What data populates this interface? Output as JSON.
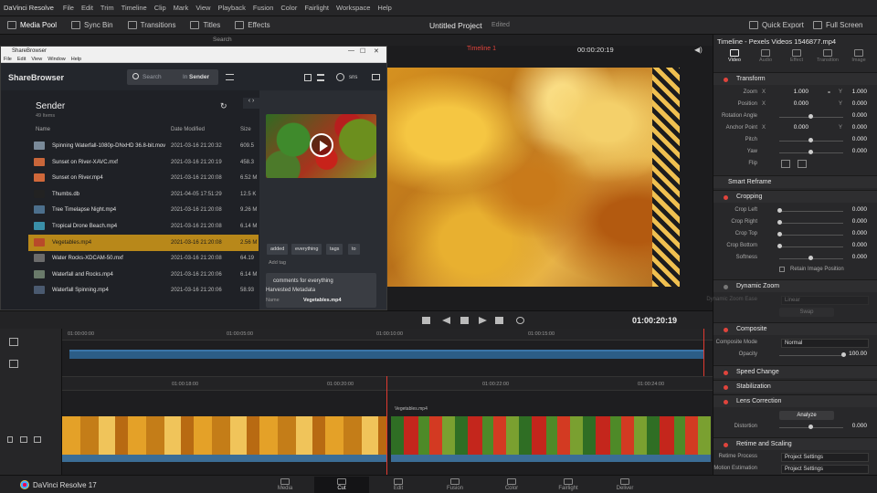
{
  "menubar": {
    "app_name": "DaVinci Resolve",
    "items": [
      "File",
      "Edit",
      "Trim",
      "Timeline",
      "Clip",
      "Mark",
      "View",
      "Playback",
      "Fusion",
      "Color",
      "Fairlight",
      "Workspace",
      "Help"
    ]
  },
  "toolbar": {
    "buttons": [
      "Media Pool",
      "Sync Bin",
      "Transitions",
      "Titles",
      "Effects"
    ],
    "project_title": "Untitled Project",
    "project_status": "Edited",
    "quick_export": "Quick Export",
    "full_screen": "Full Screen"
  },
  "subbar": {
    "search_label": "Search"
  },
  "sharebrowser": {
    "window_title": "ShareBrowser",
    "menu": [
      "File",
      "Edit",
      "View",
      "Window",
      "Help"
    ],
    "brand": "ShareBrowser",
    "search_placeholder": "Search",
    "search_in": "In",
    "search_scope": "Sender",
    "user": "sns",
    "folder": "Sender",
    "item_count": "49 Items",
    "columns": [
      "Name",
      "Date Modified",
      "Size"
    ],
    "rows": [
      {
        "name": "Spinning Waterfall-1080p-DNxHD 36.8-bit.mov",
        "date": "2021-03-16 21:20:32",
        "size": "609.5"
      },
      {
        "name": "Sunset on River-XAVC.mxf",
        "date": "2021-03-16 21:20:19",
        "size": "458.3"
      },
      {
        "name": "Sunset on River.mp4",
        "date": "2021-03-16 21:20:08",
        "size": "6.52 M"
      },
      {
        "name": "Thumbs.db",
        "date": "2021-04-05 17:51:29",
        "size": "12.5 K"
      },
      {
        "name": "Tree Timelapse Night.mp4",
        "date": "2021-03-16 21:20:08",
        "size": "9.26 M"
      },
      {
        "name": "Tropical Drone Beach.mp4",
        "date": "2021-03-16 21:20:08",
        "size": "6.14 M"
      },
      {
        "name": "Vegetables.mp4",
        "date": "2021-03-16 21:20:08",
        "size": "2.56 M"
      },
      {
        "name": "Water Rocks-XDCAM-50.mxf",
        "date": "2021-03-16 21:20:08",
        "size": "64.19"
      },
      {
        "name": "Waterfall and Rocks.mp4",
        "date": "2021-03-16 21:20:06",
        "size": "6.14 M"
      },
      {
        "name": "Waterfall Spinning.mp4",
        "date": "2021-03-16 21:20:06",
        "size": "58.93"
      }
    ],
    "selected_index": 6,
    "tags": [
      "added",
      "everything",
      "tags",
      "to"
    ],
    "add_tag": "Add tag",
    "comment": "comments for everything",
    "harvested_title": "Harvested Metadata",
    "meta_name_label": "Name",
    "meta_name_value": "Vegetables.mp4"
  },
  "viewer": {
    "timeline_name": "Timeline 1",
    "timecode": "00:00:20:19"
  },
  "transport": {
    "timecode": "01:00:20:19"
  },
  "timeline": {
    "ruler_top": [
      "01:00:00:00",
      "01:00:05:00",
      "01:00:10:00",
      "01:00:15:00"
    ],
    "ruler_bottom": [
      "01:00:18:00",
      "01:00:20:00",
      "01:00:22:00",
      "01:00:24:00"
    ],
    "clip_label": "Vegetables.mp4"
  },
  "bottom": {
    "brand": "DaVinci Resolve 17",
    "pages": [
      "Media",
      "Cut",
      "Edit",
      "Fusion",
      "Color",
      "Fairlight",
      "Deliver"
    ],
    "active_page": "Cut"
  },
  "inspector": {
    "title": "Timeline - Pexels Videos 1546877.mp4",
    "tabs": [
      "Video",
      "Audio",
      "Effect",
      "Transition",
      "Image"
    ],
    "transform": {
      "title": "Transform",
      "zoom_label": "Zoom",
      "zoom_x": "1.000",
      "zoom_y": "1.000",
      "position_label": "Position",
      "position_x": "0.000",
      "position_y": "0.000",
      "rotation_label": "Rotation Angle",
      "rotation": "0.000",
      "anchor_label": "Anchor Point",
      "anchor_x": "0.000",
      "anchor_y": "0.000",
      "pitch_label": "Pitch",
      "pitch": "0.000",
      "yaw_label": "Yaw",
      "yaw": "0.000",
      "flip_label": "Flip"
    },
    "smart_reframe": "Smart Reframe",
    "cropping": {
      "title": "Cropping",
      "left_label": "Crop Left",
      "left": "0.000",
      "right_label": "Crop Right",
      "right": "0.000",
      "top_label": "Crop Top",
      "top": "0.000",
      "bottom_label": "Crop Bottom",
      "bottom": "0.000",
      "softness_label": "Softness",
      "softness": "0.000",
      "retain_label": "Retain Image Position"
    },
    "dynamic_zoom": {
      "title": "Dynamic Zoom",
      "ease_label": "Dynamic Zoom Ease",
      "ease_value": "Linear",
      "swap": "Swap"
    },
    "composite": {
      "title": "Composite",
      "mode_label": "Composite Mode",
      "mode_value": "Normal",
      "opacity_label": "Opacity",
      "opacity": "100.00"
    },
    "speed_change": "Speed Change",
    "stabilization": "Stabilization",
    "lens_correction": {
      "title": "Lens Correction",
      "analyze": "Analyze",
      "distortion_label": "Distortion",
      "distortion": "0.000"
    },
    "retime": {
      "title": "Retime and Scaling",
      "process_label": "Retime Process",
      "process_value": "Project Settings",
      "motion_label": "Motion Estimation",
      "motion_value": "Project Settings"
    }
  }
}
